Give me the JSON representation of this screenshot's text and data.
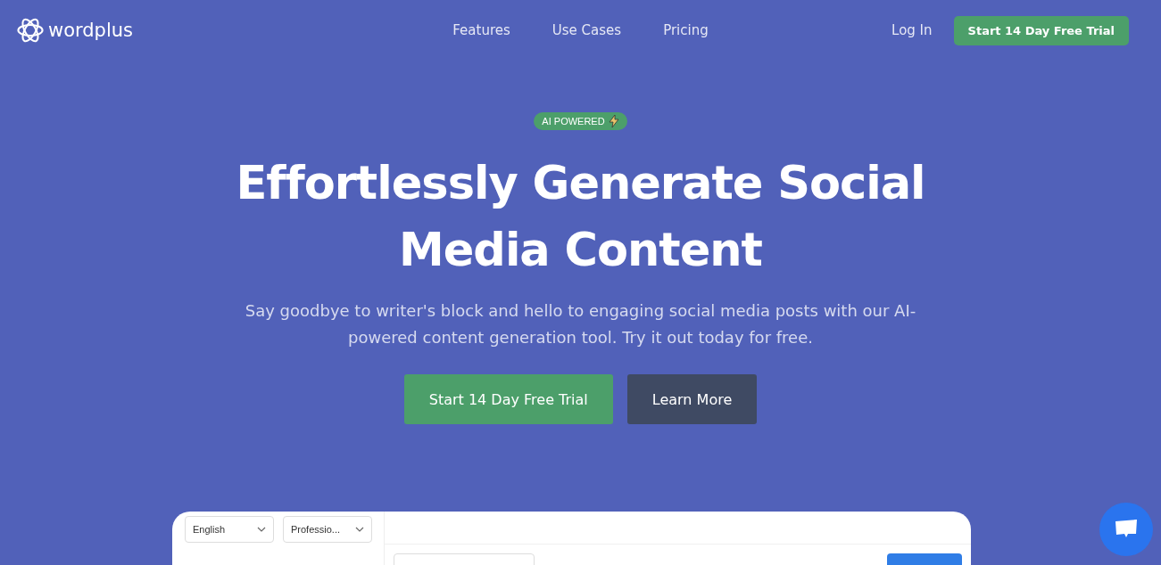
{
  "brand": {
    "name": "wordplus"
  },
  "nav": {
    "links": [
      {
        "label": "Features"
      },
      {
        "label": "Use Cases"
      },
      {
        "label": "Pricing"
      }
    ],
    "login": "Log In",
    "cta": "Start 14 Day Free Trial"
  },
  "hero": {
    "badge": "AI POWERED",
    "title": "Effortlessly Generate Social Media Content",
    "subtitle": "Say goodbye to writer's block and hello to engaging social media posts with our AI-powered content generation tool. Try it out today for free.",
    "buttons": [
      {
        "label": "Start 14 Day Free Trial",
        "kind": "primary"
      },
      {
        "label": "Learn More",
        "kind": "secondary"
      }
    ]
  },
  "preview": {
    "selects": [
      {
        "value": "English"
      },
      {
        "value": "Professio..."
      }
    ]
  }
}
